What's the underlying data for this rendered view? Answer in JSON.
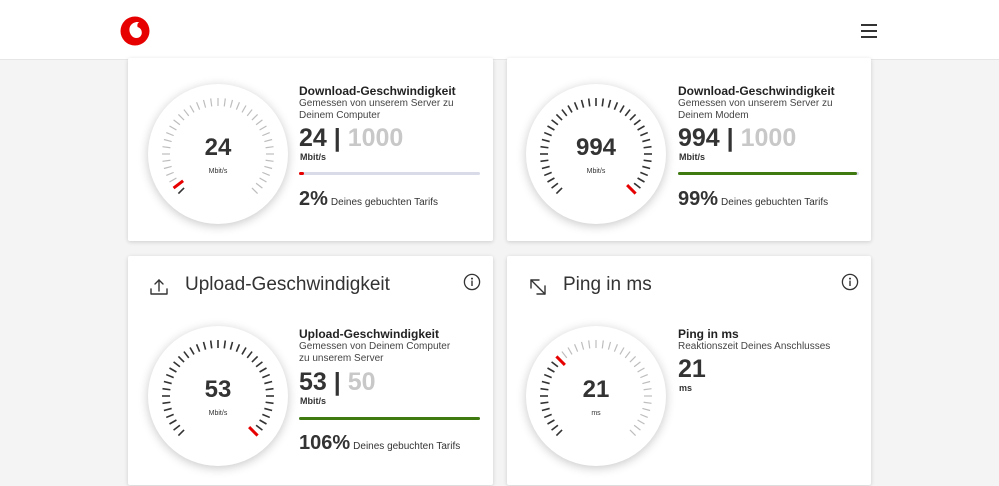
{
  "brand": {
    "accent": "#e60000",
    "good": "#3f7a11",
    "track": "#d9dbe8"
  },
  "header": {
    "logo_icon": "vodafone-logo-icon",
    "menu_icon": "hamburger-menu-icon"
  },
  "download_computer": {
    "gauge_value": "24",
    "gauge_unit": "Mbit/s",
    "fraction": 0.024,
    "title": "Download-Geschwindigkeit",
    "subtitle": "Gemessen von unserem Server zu Deinem Computer",
    "current": "24",
    "separator": "|",
    "booked": "1000",
    "unit": "Mbit/s",
    "bar_fraction": 0.02,
    "bar_color": "#e60000",
    "percent": "2%",
    "percent_label": "Deines gebuchten Tarifs"
  },
  "download_modem": {
    "gauge_value": "994",
    "gauge_unit": "Mbit/s",
    "fraction": 0.994,
    "title": "Download-Geschwindigkeit",
    "subtitle": "Gemessen von unserem Server zu Deinem Modem",
    "current": "994",
    "separator": "|",
    "booked": "1000",
    "unit": "Mbit/s",
    "bar_fraction": 0.99,
    "bar_color": "#3f7a11",
    "percent": "99%",
    "percent_label": "Deines gebuchten Tarifs"
  },
  "upload": {
    "heading": "Upload-Geschwindigkeit",
    "heading_icon": "upload-icon",
    "info_icon": "info-icon",
    "gauge_value": "53",
    "gauge_unit": "Mbit/s",
    "fraction": 1.0,
    "title": "Upload-Geschwindigkeit",
    "subtitle": "Gemessen von Deinem Computer zu unserem Server",
    "current": "53",
    "separator": "|",
    "booked": "50",
    "unit": "Mbit/s",
    "bar_fraction": 1.0,
    "bar_color": "#3f7a11",
    "percent": "106%",
    "percent_label": "Deines gebuchten Tarifs"
  },
  "ping": {
    "heading": "Ping in ms",
    "heading_icon": "ping-arrows-icon",
    "info_icon": "info-icon",
    "gauge_value": "21",
    "gauge_unit": "ms",
    "fraction": 0.33,
    "title": "Ping in ms",
    "subtitle": "Reaktionszeit Deines Anschlusses",
    "current": "21",
    "unit": "ms"
  }
}
